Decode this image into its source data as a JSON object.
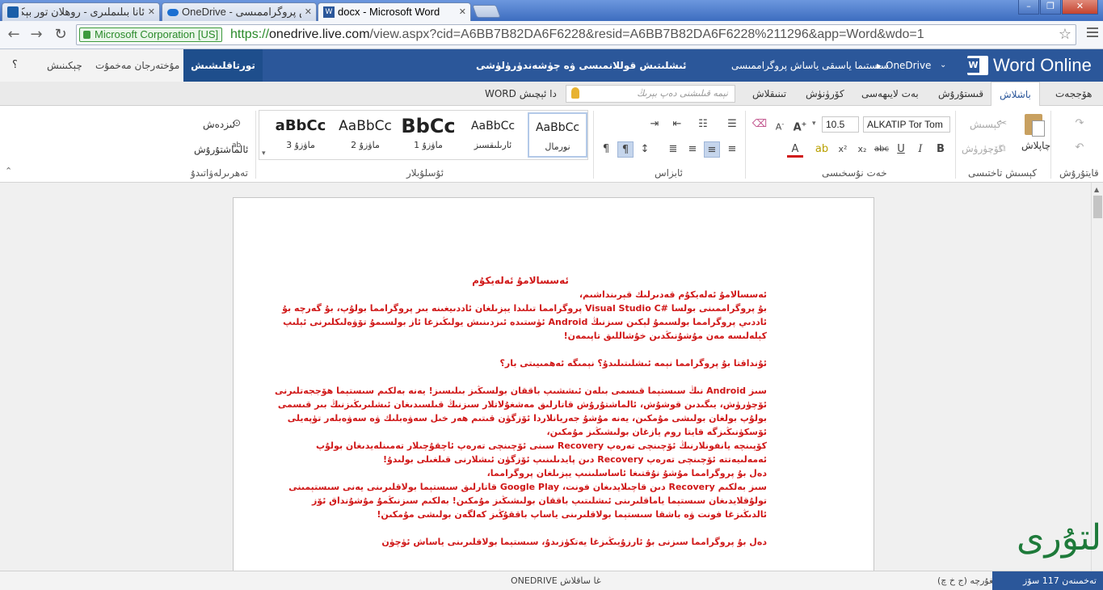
{
  "browser": {
    "tabs": [
      {
        "title": "ئانا بىلىملىرى - روھلان تور بېكىتى -"
      },
      {
        "title": "OneDrive - ئاش پروگراممىسى"
      },
      {
        "title": "docx - Microsoft Word"
      }
    ],
    "window_controls": {
      "minimize": "–",
      "maximize": "❐",
      "close": "✕"
    },
    "ev_badge": "Microsoft Corporation [US]",
    "url_scheme": "https://",
    "url_host": "onedrive.live.com",
    "url_path": "/view.aspx?cid=A6BB7B82DA6F6228&resid=A6BB7B82DA6F6228%211296&app=Word&wdo=1"
  },
  "office": {
    "app_name": "Word Online",
    "breadcrumb_root": "OneDrive",
    "breadcrumb_sep": "▸",
    "breadcrumb_folder": "سىستىما ياسىقى ياساش پروگراممىسى",
    "doc_title": "ئىشلىتىش قوللانمىسى ۋە چۈشەندۈرۈلۈشى",
    "edit_mode": "تورتاقلىشىش",
    "comments": "مۇختەرجان مەخمۇت",
    "signin": "چېكىنىش",
    "help": "؟"
  },
  "ribbon_tabs": [
    "ھۆججەت",
    "باشلاش",
    "قىستۇرۇش",
    "بەت لايىھەسى",
    "كۆرۈنۈش",
    "تىنىقلاش"
  ],
  "ribbon_tab_selected": "باشلاش",
  "tell_me": "نېمە قىلىشنى دەپ بېرىڭ",
  "open_in_word": "WORD دا ئېچىش",
  "clipboard": {
    "paste": "چاپلاش",
    "cut": "كېسىش",
    "copy": "كۆچۈرۈش",
    "group": "قايتۇرۇش",
    "group2": "كېسىش تاختىسى"
  },
  "font": {
    "name": "ALKATIP Tor Tom",
    "size": "10.5",
    "group": "خەت نۇسخىسى"
  },
  "paragraph": {
    "group": "ئابزاس"
  },
  "styles": {
    "group": "ئۇسلۇبلار",
    "items": [
      {
        "preview": "AaBbCc",
        "name": "نورمال"
      },
      {
        "preview": "AaBbCc",
        "name": "ئارىلىقسىز"
      },
      {
        "preview": "BbCc",
        "name": "ماۋزۇ 1"
      },
      {
        "preview": "AaBbCc",
        "name": "ماۋزۇ 2"
      },
      {
        "preview": "aBbCc",
        "name": "ماۋزۇ 3"
      }
    ]
  },
  "editing": {
    "find": "ئىزدەش",
    "replace": "ئالماشتۇرۇش",
    "group": "تەھرىرلەۋاتىدۇ"
  },
  "document": {
    "title": "ئەسسالامۇ ئەلەيكۇم",
    "lines": [
      "ئەسسالامۇ ئەلەيكۇم قەدىرلىك قېرىنداشىم،",
      "بۇ پروگراممىنى بولسا #Visual Studio C پروگرامما تىلىدا يېزىلغان ئاددىيغىنە بىر پروگرامما بولۇپ، بۇ گەرچە بۇ",
      "ئاددىي پروگرامما بولسىمۇ لېكىن سىزنىڭ Android ئۈستىدە ئىزدىنىش يولىڭىزغا ئاز بولسىمۇ تۆۋەلىكلىرنى ئېلىپ",
      "كېلەلىسە مەن مۇشۇنىڭدىن خۇشاللىق تاپىمەن!",
      "",
      "ئۇنداقتا بۇ پروگرامما نېمە ئىشلىتىلىدۇ؟ نېمىگە ئەھمىيىتى بار؟",
      "",
      "سىز Android نىڭ سىستېما قىسمى بىلەن ئىششىپ باققان بولسىڭىز بىلىسىز! يەنە بەلكىم سىستېما ھۆججەتلىرنى",
      "ئۆچۈرۈش، يىگىدىن قوشۇش، ئالماشتۇرۇش قاتارلىق مەشغۇلاتلار سىزنىڭ قىلسىدىغان ئىشلىرىڭىزنىڭ بىر قىسمى",
      "بولۇپ بولغان بولىشى مۇمكىن، يەنە مۇشۇ جەريانلاردا ئۆزگۈن قىتىم ھەر خىل سەۋەبلىك ۋە سەۋەبلەر تۈپەيلى",
      "ئۆسكۈنىڭىزگە قايتا روم يازغان بولىشىڭىز مۇمكىن،",
      "كۆپىنچە يانفونلارنىڭ ئۆچىنچى تەرەپ Recovery سىنى ئۆچىنچى تەرەپ ئاچقۇچىلار تەمىنلەيدىغان بولۇپ",
      "ئەمەلىيەتتە ئۆچىنچى تەرەپ Recovery دىن پايدىلىنىپ ئۆزگۈن ئىشلارنى قىلغىلى بولىدۇ!",
      "دەل بۇ پروگرامما مۇشۇ نۇقتىغا ئاساسلىنىپ يېزىلغان پروگرامما،",
      "سىز بەلكىم Recovery دىن قاچىلايدىغان فونت، Google Play قاتارلىق سىستېما بولاقلىرىنى يەنى سىستېمىنى",
      "تولۇقلايدىغان سىستېما ياماقلىرىنى ئىشلىتىپ باققان بولىشىڭىز مۇمكىن! بەلكىم سىزنىڭمۇ مۇشۇنداق ئۆز",
      "ئالدىڭىزغا فونت ۋە باشقا سىستېما بولاقلىرىنى ياساپ باققۇڭىز كەلگەن بولىشى مۇمكىن!",
      "",
      "دەل بۇ پروگرامما سىزنى بۇ ئارزۇيىڭىزغا يەتكۈزىدۇ، سىستېما بولاقلىرىنى ياساش ئۈچۈن"
    ]
  },
  "status": {
    "words": "تەخمىنەن 117 سۆز",
    "lang": "ئۇيغۇرچە (ج خ چ)",
    "saved": "ONEDRIVE غا ساقلاش"
  },
  "watermark": "ئالتۇرى",
  "colors": {
    "accent": "#2b579a",
    "doc_text": "#d01818"
  }
}
